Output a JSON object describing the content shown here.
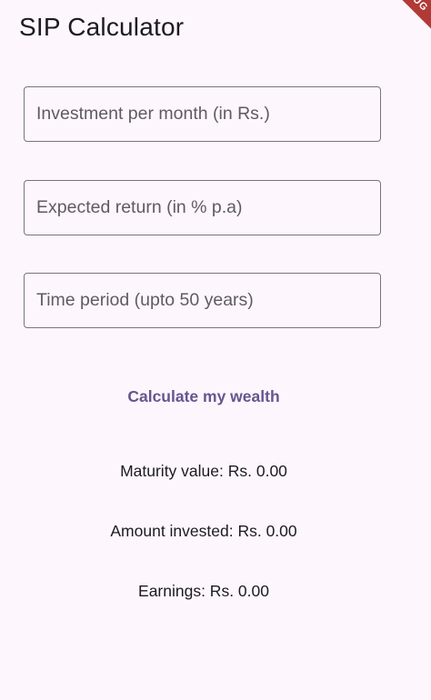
{
  "app": {
    "title": "SIP Calculator",
    "debug_banner": "DEBUG"
  },
  "form": {
    "investment_placeholder": "Investment per month (in Rs.)",
    "return_placeholder": "Expected return (in % p.a)",
    "period_placeholder": "Time period (upto 50 years)",
    "investment_value": "",
    "return_value": "",
    "period_value": ""
  },
  "actions": {
    "calculate_label": "Calculate my wealth"
  },
  "results": {
    "maturity": "Maturity value: Rs. 0.00",
    "invested": "Amount invested: Rs. 0.00",
    "earnings": "Earnings: Rs. 0.00"
  },
  "colors": {
    "background": "#fdf6fd",
    "accent": "#66558e",
    "field_border": "#79747e",
    "debug_ribbon": "#b13a36"
  }
}
